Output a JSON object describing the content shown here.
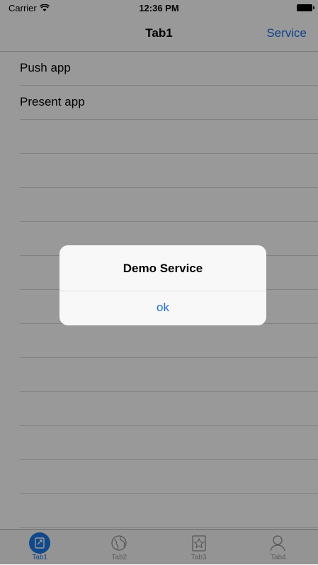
{
  "status_bar": {
    "carrier": "Carrier",
    "time": "12:36 PM"
  },
  "nav_bar": {
    "title": "Tab1",
    "right_button": "Service"
  },
  "table": {
    "rows": [
      "Push app",
      "Present app",
      "",
      "",
      "",
      "",
      "",
      "",
      "",
      "",
      "",
      "",
      "",
      ""
    ]
  },
  "alert": {
    "title": "Demo Service",
    "button": "ok"
  },
  "tab_bar": {
    "items": [
      {
        "label": "Tab1",
        "icon": "document-icon",
        "active": true
      },
      {
        "label": "Tab2",
        "icon": "globe-icon",
        "active": false
      },
      {
        "label": "Tab3",
        "icon": "star-icon",
        "active": false
      },
      {
        "label": "Tab4",
        "icon": "person-icon",
        "active": false
      }
    ]
  },
  "colors": {
    "accent": "#1a6ee8",
    "overlay": "rgba(0,0,0,0.4)"
  }
}
